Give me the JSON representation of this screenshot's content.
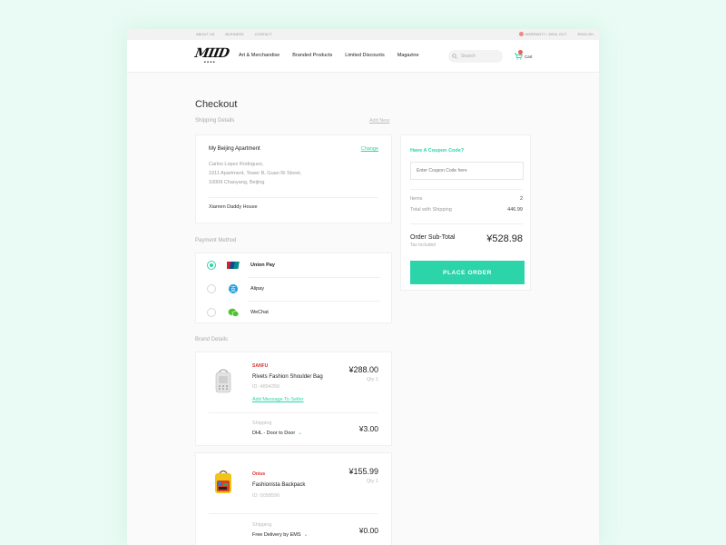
{
  "topbar": {
    "left_links": [
      "ABOUT US",
      "BUSINESS",
      "CONTACT"
    ],
    "warranty": "WARRANTY / DEAL OUT",
    "language": "ENGLISH"
  },
  "header": {
    "logo_text": "MIID",
    "logo_sub": "■■■■",
    "nav": [
      "Art & Merchandise",
      "Branded Products",
      "Limited Discounts",
      "Magazine"
    ],
    "search_placeholder": "Search",
    "cart_label": "Cart"
  },
  "checkout": {
    "title": "Checkout",
    "shipping_label": "Shipping Details",
    "add_new": "Add New",
    "address": {
      "title": "My Beijing Apartment",
      "change": "Change",
      "lines": [
        "Carlos Lopez Rodriguez,",
        "1911 Apartment, Tower B, Guan Ri Street,",
        "10009 Chaoyang, Beijing"
      ],
      "alternate": "Xiamen Daddy House"
    },
    "payment_label": "Payment Method",
    "payment_methods": [
      {
        "label": "Union Pay",
        "selected": true,
        "icon": "unionpay-icon"
      },
      {
        "label": "Alipay",
        "selected": false,
        "icon": "alipay-icon"
      },
      {
        "label": "WeChat",
        "selected": false,
        "icon": "wechat-icon"
      }
    ],
    "brand_label": "Brand Details",
    "products": [
      {
        "brand": "SANFU",
        "name": "Rivets Fashion Shoulder Bag",
        "id": "ID: 4894350",
        "message_link": "Add Message To Seller",
        "price": "¥288.00",
        "qty": "Qty 1",
        "shipping_label": "Shipping",
        "shipping_method": "DHL - Door to Door",
        "shipping_price": "¥3.00"
      },
      {
        "brand": "Onius",
        "name": "Fashionista Backpack",
        "id": "ID: 0058590",
        "price": "¥155.99",
        "qty": "Qty 1",
        "shipping_label": "Shipping",
        "shipping_method": "Free Delivery by EMS",
        "shipping_price": "¥0.00"
      }
    ]
  },
  "summary": {
    "coupon_title": "Have A Coupon Code?",
    "coupon_placeholder": "Enter Coupon Code here",
    "items_label": "Items",
    "items_value": "2",
    "total_label": "Total with Shipping",
    "total_value": "446.99",
    "subtotal_label": "Order Sub-Total",
    "tax_note": "Tax Included",
    "subtotal_value": "¥528.98",
    "button": "PLACE ORDER"
  },
  "colors": {
    "accent": "#2bd4a9",
    "background": "#e9fbf4",
    "badge": "#f25c54"
  }
}
